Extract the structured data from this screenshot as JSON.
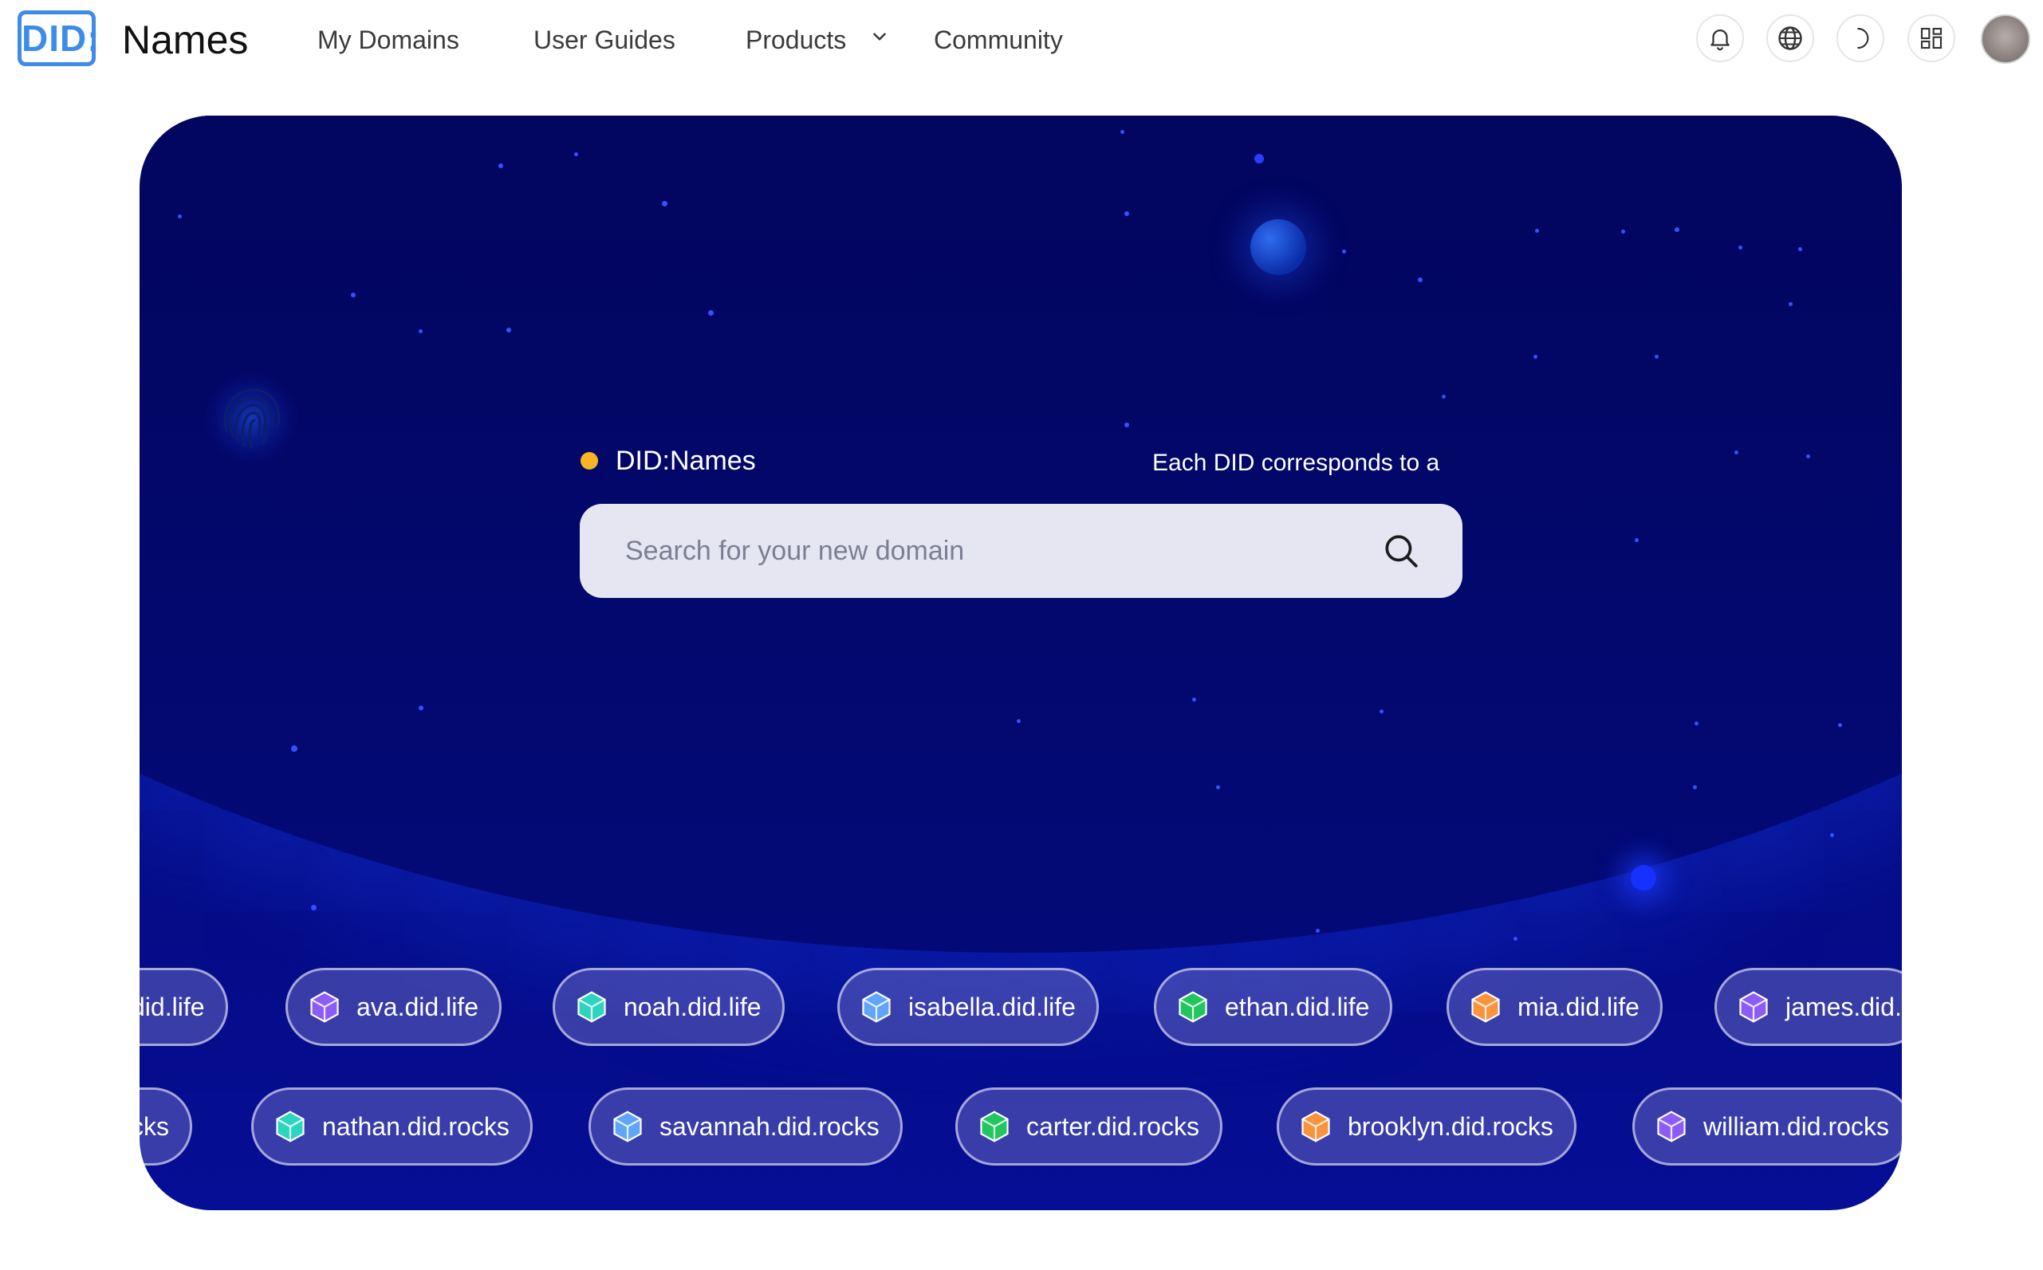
{
  "header": {
    "logo_mark": "DID:",
    "logo_name": "Names",
    "nav": {
      "my_domains": "My Domains",
      "user_guides": "User Guides",
      "products": "Products",
      "community": "Community"
    },
    "icons": [
      "bell-icon",
      "globe-icon",
      "moon-icon",
      "grid-icon"
    ]
  },
  "hero": {
    "tagline": "DID:Names",
    "subtag": "Each DID corresponds to a",
    "search": {
      "placeholder": "Search for your new domain"
    },
    "row1": [
      {
        "label": "did.life",
        "color": "#8b5cf6"
      },
      {
        "label": "ava.did.life",
        "color": "#8b5cf6"
      },
      {
        "label": "noah.did.life",
        "color": "#2dd4bf"
      },
      {
        "label": "isabella.did.life",
        "color": "#60a5fa"
      },
      {
        "label": "ethan.did.life",
        "color": "#22c55e"
      },
      {
        "label": "mia.did.life",
        "color": "#fb923c"
      },
      {
        "label": "james.did.",
        "color": "#8b5cf6"
      }
    ],
    "row2": [
      {
        "label": "cks",
        "color": "#8b5cf6"
      },
      {
        "label": "nathan.did.rocks",
        "color": "#2dd4bf"
      },
      {
        "label": "savannah.did.rocks",
        "color": "#60a5fa"
      },
      {
        "label": "carter.did.rocks",
        "color": "#22c55e"
      },
      {
        "label": "brooklyn.did.rocks",
        "color": "#fb923c"
      },
      {
        "label": "william.did.rocks",
        "color": "#8b5cf6"
      }
    ]
  },
  "colors": {
    "brand": "#3d8de8",
    "accent_dot": "#f8b422",
    "hero_bg": "#040a78"
  }
}
